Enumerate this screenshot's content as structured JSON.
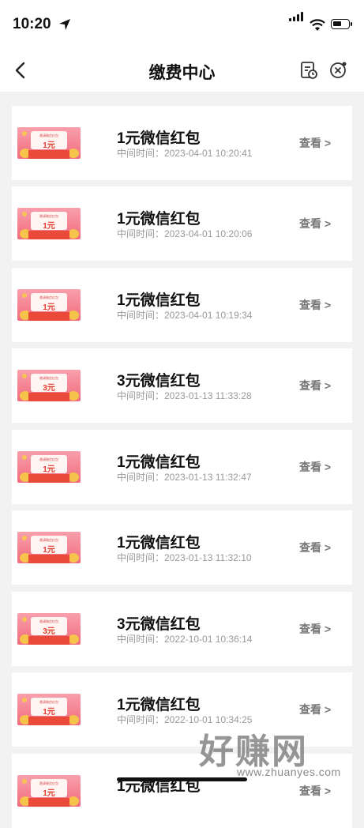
{
  "status": {
    "time": "10:20"
  },
  "nav": {
    "title": "缴费中心"
  },
  "items": [
    {
      "title": "1元微信红包",
      "time": "中间时间：2023-04-01 10:20:41",
      "action": "查看 >",
      "ticket_value": "1元"
    },
    {
      "title": "1元微信红包",
      "time": "中间时间：2023-04-01 10:20:06",
      "action": "查看 >",
      "ticket_value": "1元"
    },
    {
      "title": "1元微信红包",
      "time": "中间时间：2023-04-01 10:19:34",
      "action": "查看 >",
      "ticket_value": "1元"
    },
    {
      "title": "3元微信红包",
      "time": "中间时间：2023-01-13 11:33:28",
      "action": "查看 >",
      "ticket_value": "3元"
    },
    {
      "title": "1元微信红包",
      "time": "中间时间：2023-01-13 11:32:47",
      "action": "查看 >",
      "ticket_value": "1元"
    },
    {
      "title": "1元微信红包",
      "time": "中间时间：2023-01-13 11:32:10",
      "action": "查看 >",
      "ticket_value": "1元"
    },
    {
      "title": "3元微信红包",
      "time": "中间时间：2022-10-01 10:36:14",
      "action": "查看 >",
      "ticket_value": "3元"
    },
    {
      "title": "1元微信红包",
      "time": "中间时间：2022-10-01 10:34:25",
      "action": "查看 >",
      "ticket_value": "1元"
    },
    {
      "title": "1元微信红包",
      "time": "",
      "action": "查看 >",
      "ticket_value": "1元"
    }
  ],
  "ticket_caption": "邀请微信红包",
  "watermark": {
    "main": "好赚网",
    "sub": "www.zhuanyes.com"
  }
}
